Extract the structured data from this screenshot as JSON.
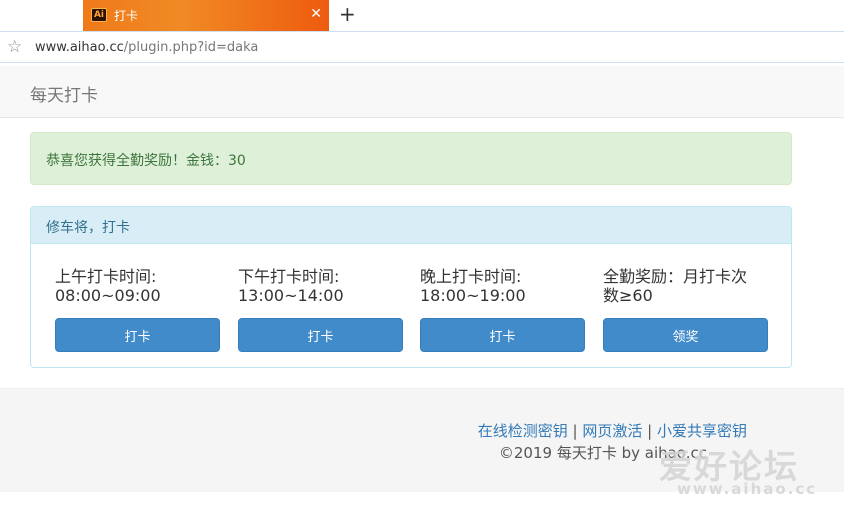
{
  "browser": {
    "tab": {
      "favicon": "Ai",
      "title": "打卡",
      "close": "✕"
    },
    "new_tab": "+",
    "url": {
      "host": "www.aihao.cc",
      "path": "/plugin.php?id=daka"
    }
  },
  "navbar": {
    "brand": "每天打卡"
  },
  "alert": {
    "text": "恭喜您获得全勤奖励！金钱：30",
    "color": "#3c763d"
  },
  "panel": {
    "title": "修车将，打卡",
    "columns": [
      {
        "line1": "上午打卡时间:",
        "line2": "08:00~09:00",
        "button": "打卡"
      },
      {
        "line1": "下午打卡时间:",
        "line2": "13:00~14:00",
        "button": "打卡"
      },
      {
        "line1": "晚上打卡时间:",
        "line2": "18:00~19:00",
        "button": "打卡"
      },
      {
        "line1": "全勤奖励：月打卡次",
        "line2": "数≥60",
        "button": "领奖"
      }
    ]
  },
  "footer": {
    "links": [
      "在线检测密钥",
      "网页激活",
      "小爱共享密钥"
    ],
    "separator": "|",
    "copyright": "©2019 每天打卡 by aihao.cc"
  },
  "watermark": {
    "main": "爱好论坛",
    "sub": "www.aihao.cc"
  },
  "colors": {
    "primary": "#428bca",
    "tab": "#ef7a1a",
    "panel_heading": "#d9edf7"
  }
}
